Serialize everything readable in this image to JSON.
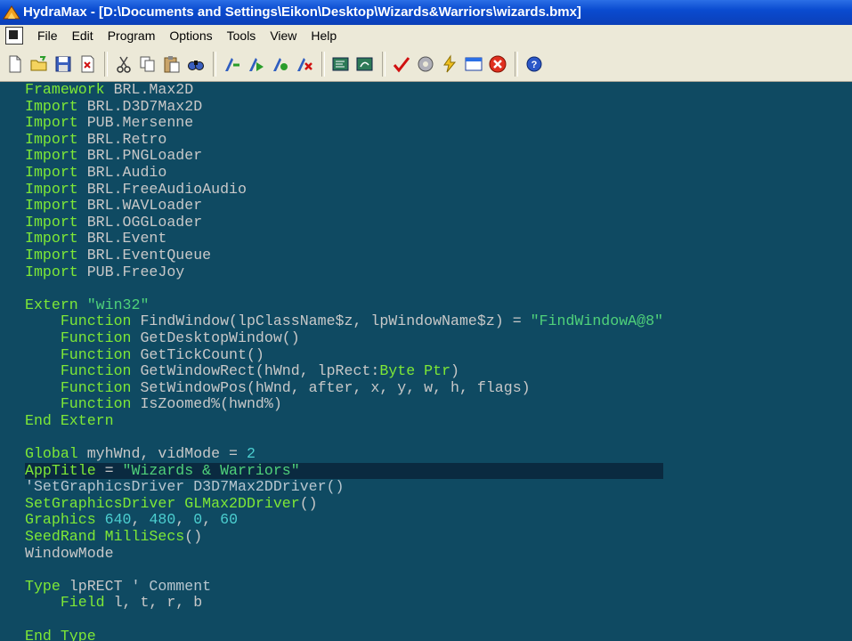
{
  "window": {
    "title": "HydraMax - [D:\\Documents and Settings\\Eikon\\Desktop\\Wizards&Warriors\\wizards.bmx]"
  },
  "menu": [
    "File",
    "Edit",
    "Program",
    "Options",
    "Tools",
    "View",
    "Help"
  ],
  "toolbar_icons": [
    "new-file-icon",
    "open-folder-icon",
    "save-icon",
    "close-file-icon",
    "cut-icon",
    "copy-icon",
    "paste-icon",
    "find-icon",
    "build-icon",
    "build-run-icon",
    "build-debug-icon",
    "stop-build-icon",
    "step-icon",
    "step-over-icon",
    "check-icon",
    "settings-icon",
    "quickrun-icon",
    "window-icon",
    "stop-icon",
    "help-icon"
  ],
  "code_lines": [
    "Framework BRL.Max2D",
    "Import BRL.D3D7Max2D",
    "Import PUB.Mersenne",
    "Import BRL.Retro",
    "Import BRL.PNGLoader",
    "Import BRL.Audio",
    "Import BRL.FreeAudioAudio",
    "Import BRL.WAVLoader",
    "Import BRL.OGGLoader",
    "Import BRL.Event",
    "Import BRL.EventQueue",
    "Import PUB.FreeJoy",
    "",
    "Extern \"win32\"",
    "    Function FindWindow(lpClassName$z, lpWindowName$z) = \"FindWindowA@8\"",
    "    Function GetDesktopWindow()",
    "    Function GetTickCount()",
    "    Function GetWindowRect(hWnd, lpRect:Byte Ptr)",
    "    Function SetWindowPos(hWnd, after, x, y, w, h, flags)",
    "    Function IsZoomed%(hwnd%)",
    "End Extern",
    "",
    "Global myhWnd, vidMode = 2",
    "AppTitle = \"Wizards & Warriors\"",
    "'SetGraphicsDriver D3D7Max2DDriver()",
    "SetGraphicsDriver GLMax2DDriver()",
    "Graphics 640, 480, 0, 60",
    "SeedRand MilliSecs()",
    "WindowMode",
    "",
    "Type lpRECT ' Comment",
    "    Field l, t, r, b",
    "",
    "End Type"
  ],
  "colors": {
    "editor_bg": "#0f4a62",
    "keyword": "#7ee836",
    "string": "#4fd17a",
    "number": "#4ccfd0",
    "text": "#c8c8c8"
  }
}
